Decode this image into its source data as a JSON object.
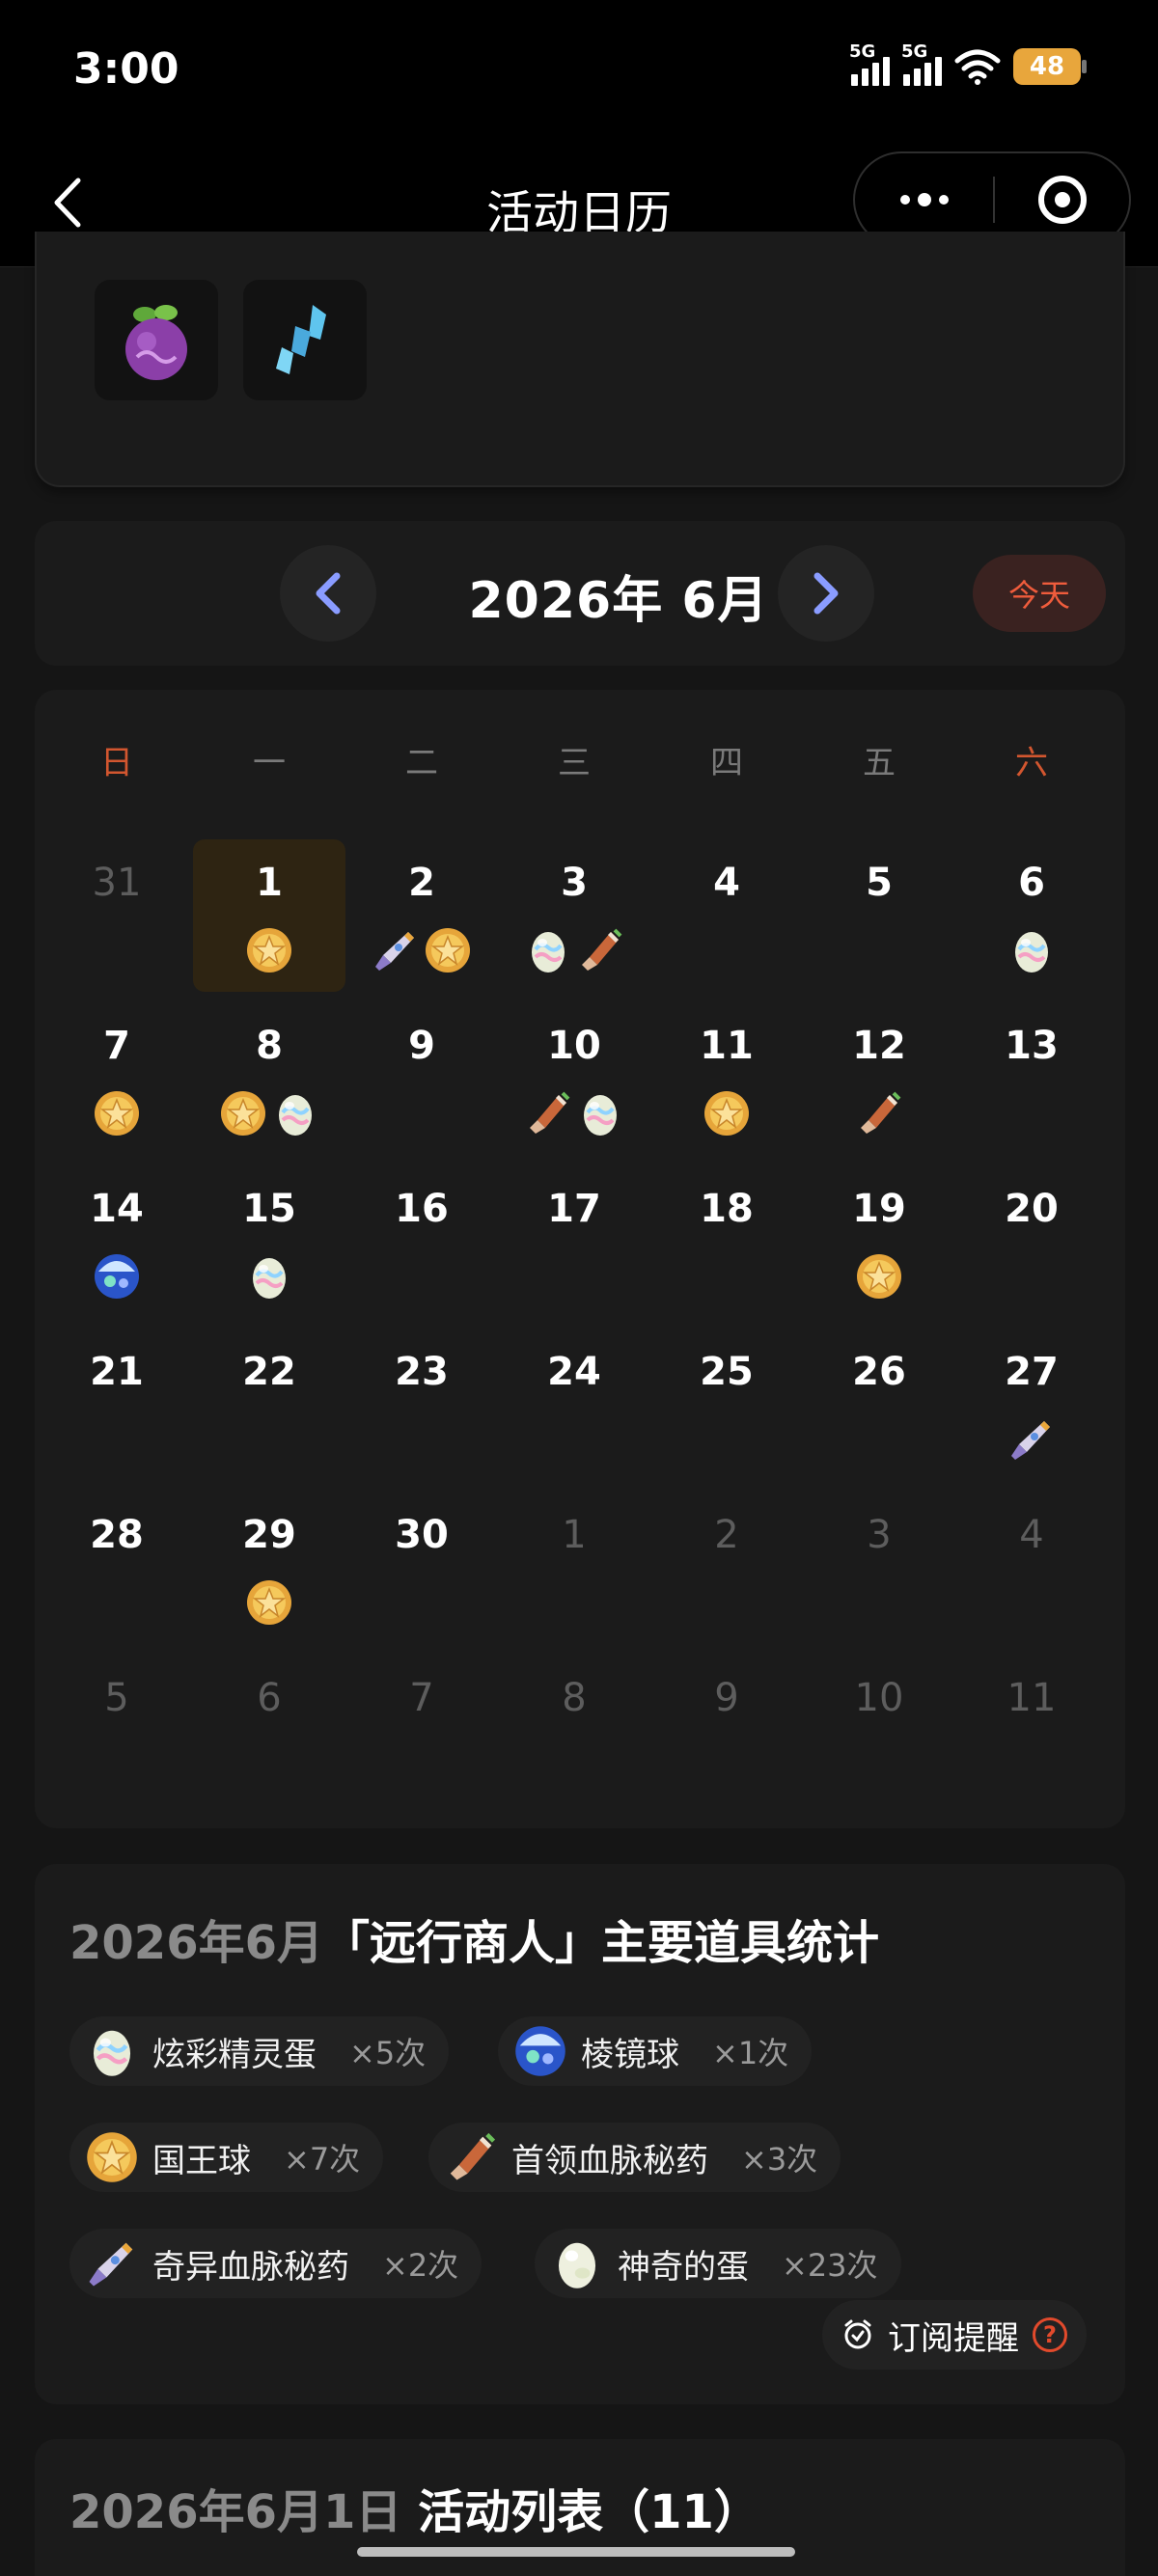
{
  "status_bar": {
    "time": "3:00",
    "net1": "5G",
    "net2": "5G",
    "battery": "48"
  },
  "nav": {
    "title": "活动日历"
  },
  "month_header": {
    "label": "2026年 6月",
    "today_label": "今天"
  },
  "weekdays": [
    "日",
    "一",
    "二",
    "三",
    "四",
    "五",
    "六"
  ],
  "weeks": [
    [
      {
        "d": "31",
        "o": true,
        "i": []
      },
      {
        "d": "1",
        "t": true,
        "i": [
          "gold"
        ]
      },
      {
        "d": "2",
        "i": [
          "rocket",
          "gold"
        ]
      },
      {
        "d": "3",
        "i": [
          "egg",
          "potion"
        ]
      },
      {
        "d": "4",
        "i": []
      },
      {
        "d": "5",
        "i": []
      },
      {
        "d": "6",
        "i": [
          "egg"
        ]
      }
    ],
    [
      {
        "d": "7",
        "i": [
          "gold"
        ]
      },
      {
        "d": "8",
        "i": [
          "gold",
          "egg"
        ]
      },
      {
        "d": "9",
        "i": []
      },
      {
        "d": "10",
        "i": [
          "potion",
          "egg"
        ]
      },
      {
        "d": "11",
        "i": [
          "gold"
        ]
      },
      {
        "d": "12",
        "i": [
          "potion"
        ]
      },
      {
        "d": "13",
        "i": []
      }
    ],
    [
      {
        "d": "14",
        "i": [
          "prism"
        ]
      },
      {
        "d": "15",
        "i": [
          "egg"
        ]
      },
      {
        "d": "16",
        "i": []
      },
      {
        "d": "17",
        "i": []
      },
      {
        "d": "18",
        "i": []
      },
      {
        "d": "19",
        "i": [
          "gold"
        ]
      },
      {
        "d": "20",
        "i": []
      }
    ],
    [
      {
        "d": "21",
        "i": []
      },
      {
        "d": "22",
        "i": []
      },
      {
        "d": "23",
        "i": []
      },
      {
        "d": "24",
        "i": []
      },
      {
        "d": "25",
        "i": []
      },
      {
        "d": "26",
        "i": []
      },
      {
        "d": "27",
        "i": [
          "rocket"
        ]
      }
    ],
    [
      {
        "d": "28",
        "i": []
      },
      {
        "d": "29",
        "i": [
          "gold"
        ]
      },
      {
        "d": "30",
        "i": []
      },
      {
        "d": "1",
        "o": true,
        "i": []
      },
      {
        "d": "2",
        "o": true,
        "i": []
      },
      {
        "d": "3",
        "o": true,
        "i": []
      },
      {
        "d": "4",
        "o": true,
        "i": []
      }
    ],
    [
      {
        "d": "5",
        "o": true,
        "i": []
      },
      {
        "d": "6",
        "o": true,
        "i": []
      },
      {
        "d": "7",
        "o": true,
        "i": []
      },
      {
        "d": "8",
        "o": true,
        "i": []
      },
      {
        "d": "9",
        "o": true,
        "i": []
      },
      {
        "d": "10",
        "o": true,
        "i": []
      },
      {
        "d": "11",
        "o": true,
        "i": []
      }
    ]
  ],
  "stats": {
    "title_prefix": "2026年6月",
    "title_main": "「远行商人」主要道具统计",
    "items": [
      {
        "icon": "egg",
        "name": "炫彩精灵蛋",
        "count": "×5次"
      },
      {
        "icon": "prism",
        "name": "棱镜球",
        "count": "×1次"
      },
      {
        "icon": "gold",
        "name": "国王球",
        "count": "×7次"
      },
      {
        "icon": "potion",
        "name": "首领血脉秘药",
        "count": "×3次"
      },
      {
        "icon": "rocket",
        "name": "奇异血脉秘药",
        "count": "×2次"
      },
      {
        "icon": "plain-egg",
        "name": "神奇的蛋",
        "count": "×23次"
      }
    ],
    "subscribe_label": "订阅提醒",
    "help_glyph": "?"
  },
  "activity": {
    "title_prefix": "2026年6月1日",
    "title_main": "活动列表（11）"
  },
  "colors": {
    "accent": "#ef5c3c",
    "today_bg": "#2e2412",
    "arrow": "#8a9cff"
  }
}
